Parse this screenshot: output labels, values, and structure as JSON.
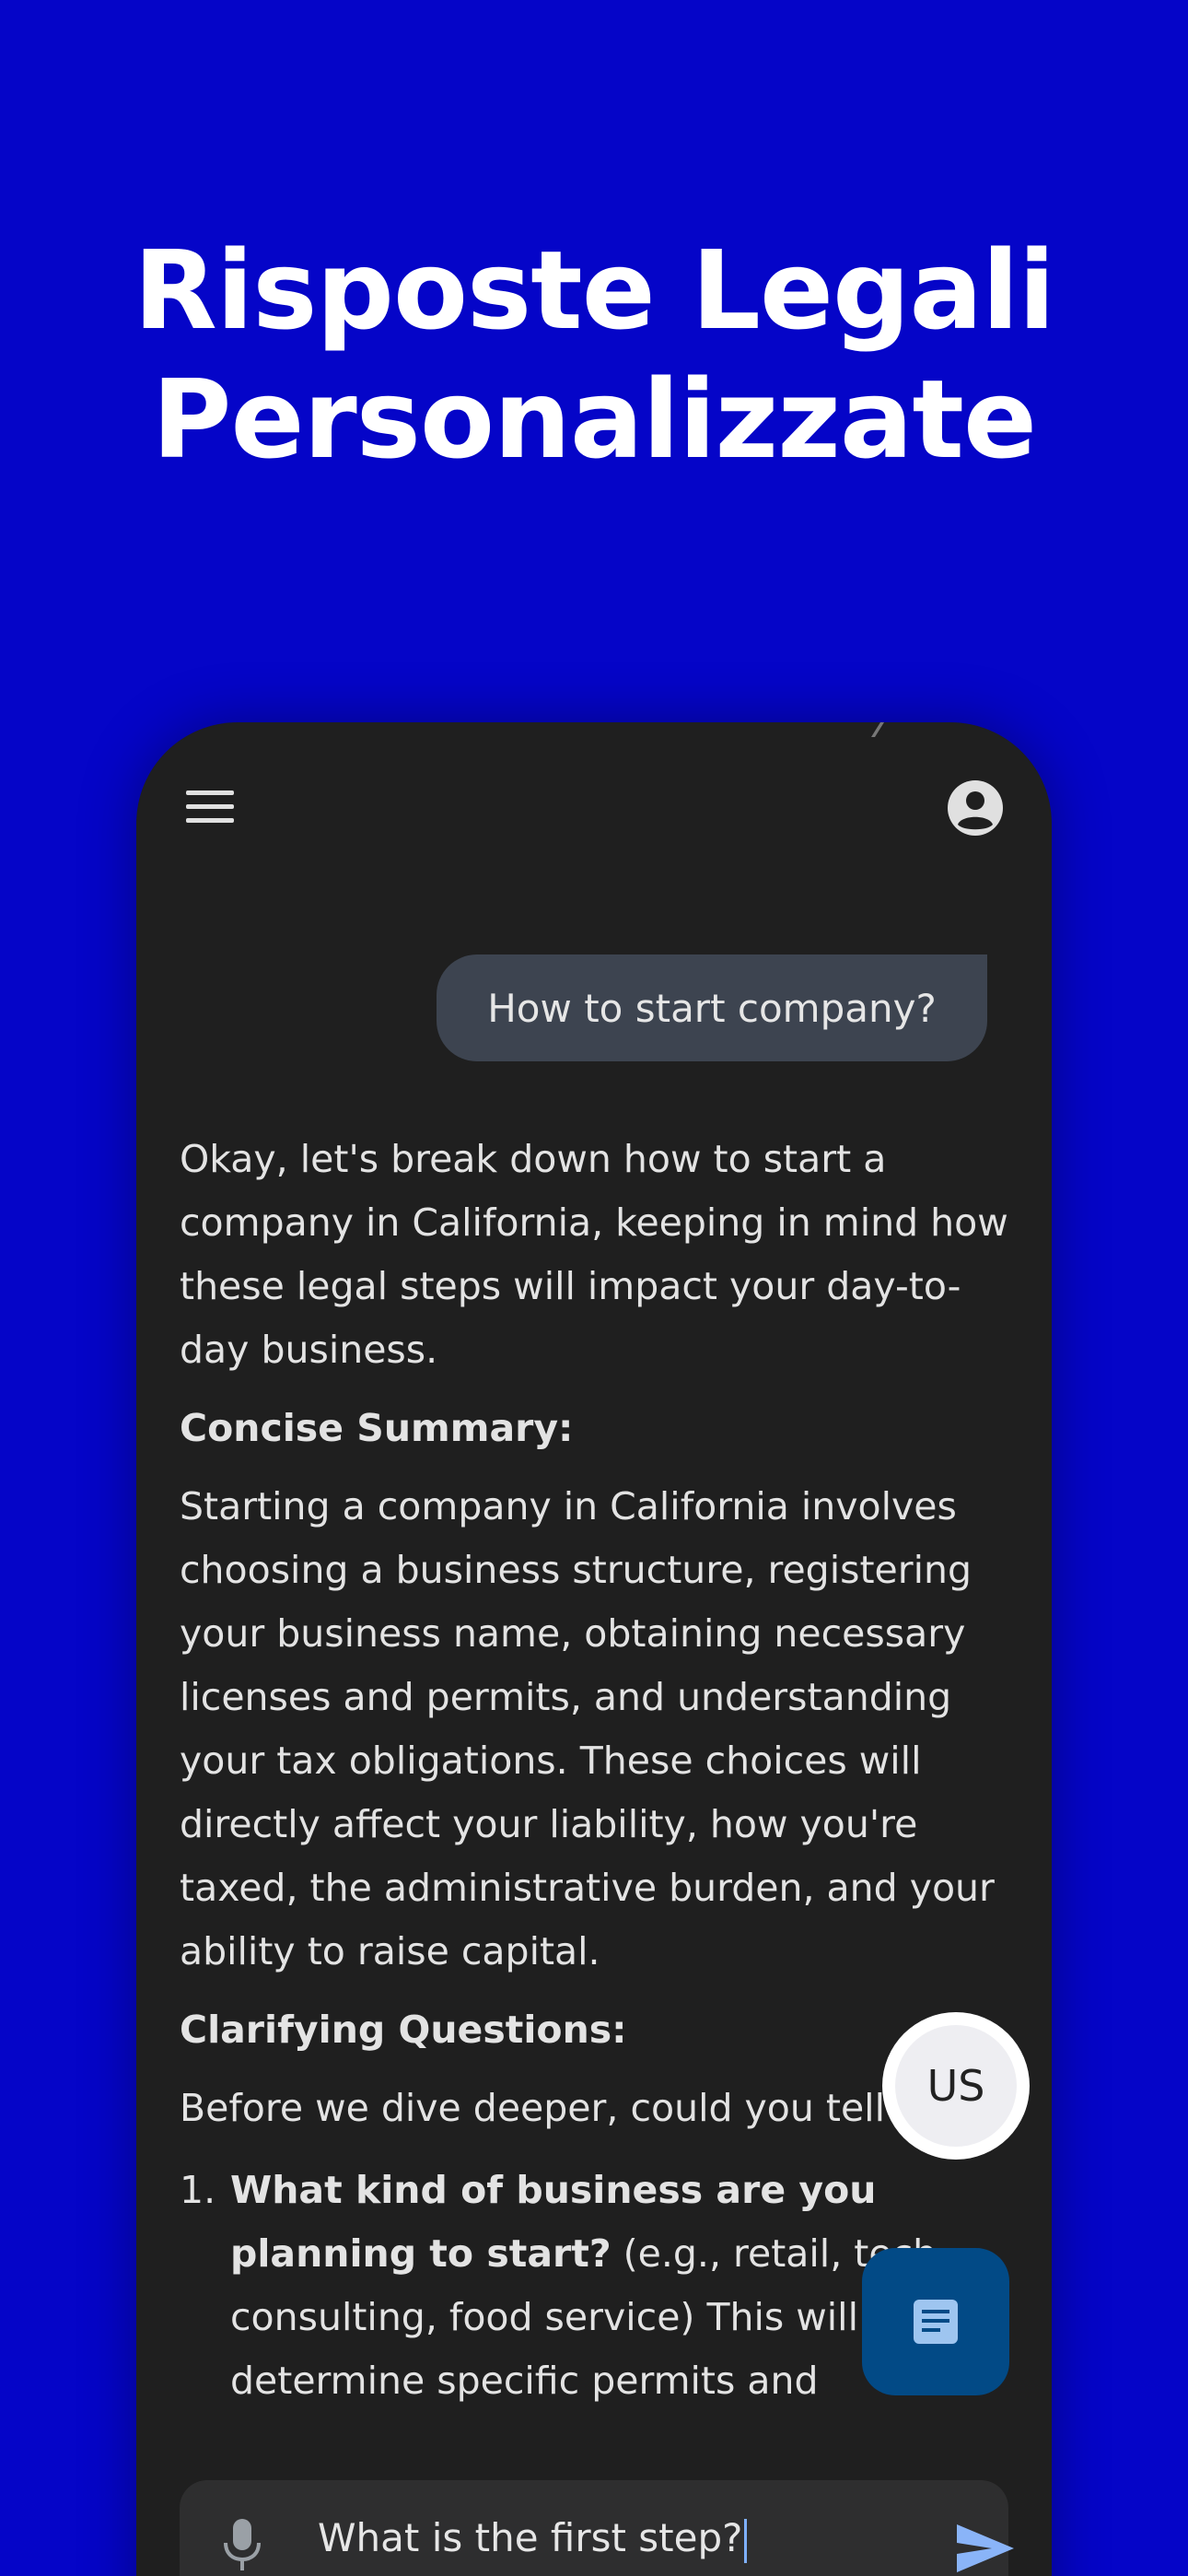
{
  "headline": {
    "line1": "Risposte Legali",
    "line2": "Personalizzate"
  },
  "app": {
    "user_message": "How to start company?",
    "response": {
      "intro": "Okay, let's break down how to start a company in California, keeping in mind how these legal steps will impact your day-to-day business.",
      "summary_heading": "Concise Summary:",
      "summary_text": "Starting a company in California involves choosing a business structure, registering your business name, obtaining necessary licenses and permits, and understanding your tax obligations. These choices will directly affect your liability, how you're taxed, the administrative burden, and your ability to raise capital.",
      "clarify_heading": "Clarifying Questions:",
      "clarify_intro": "Before we dive deeper, could you tell me:",
      "questions": [
        {
          "num": "1.",
          "bold": "What kind of business are you planning to start?",
          "rest": " (e.g., retail, tech, consulting, food service) This will help determine specific permits and"
        }
      ]
    },
    "language_button": "US",
    "input": {
      "value": "What is the first step?"
    }
  },
  "icons": {
    "menu": "menu-icon",
    "account": "account-circle-icon",
    "mic": "mic-icon",
    "send": "send-icon",
    "document": "document-icon"
  },
  "colors": {
    "background": "#0505c8",
    "phone": "#1f1f1f",
    "user_bubble": "#3d4450",
    "doc_button": "#024a86",
    "send": "#8ab4f8"
  }
}
